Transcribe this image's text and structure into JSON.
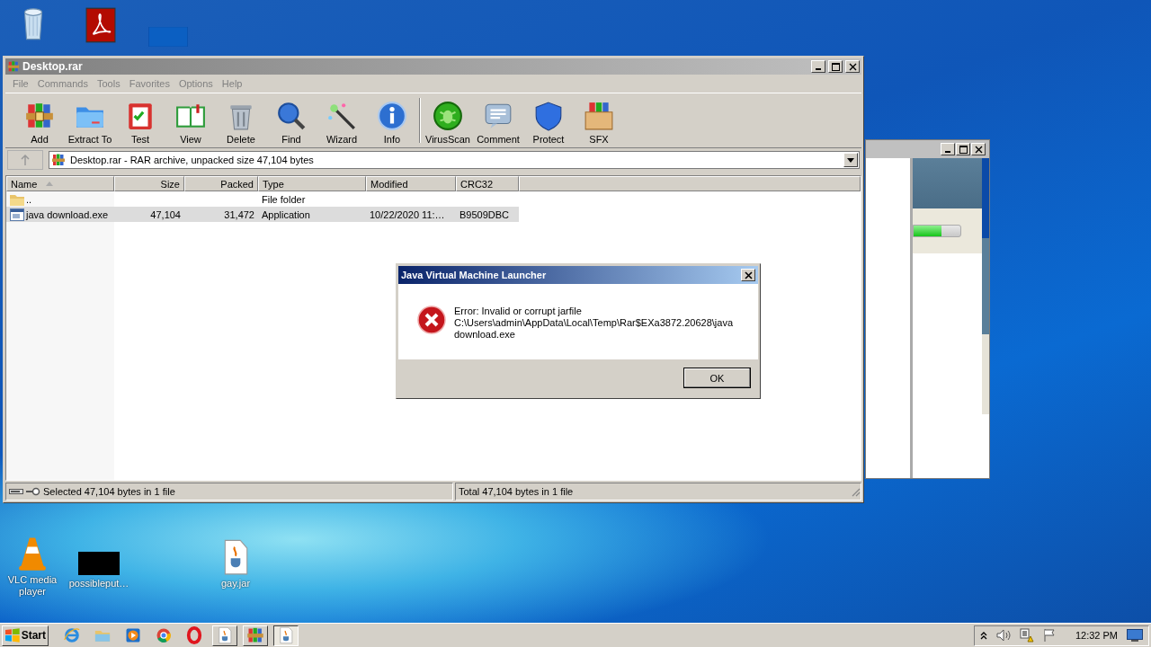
{
  "desktop_icons": [
    {
      "kind": "recycle"
    },
    {
      "kind": "acrobat"
    },
    {
      "kind": "blank"
    },
    {
      "kind": "vlc",
      "label": "VLC media player"
    },
    {
      "kind": "thumbnail",
      "label": "possibleput…"
    },
    {
      "kind": "jar",
      "label": "gay.jar"
    }
  ],
  "background_window": {
    "progress": {
      "level": 0.6
    }
  },
  "winrar": {
    "title": "Desktop.rar",
    "menu": [
      "File",
      "Commands",
      "Tools",
      "Favorites",
      "Options",
      "Help"
    ],
    "toolbar": [
      {
        "kind": "add",
        "label": "Add"
      },
      {
        "kind": "extract",
        "label": "Extract To"
      },
      {
        "kind": "test",
        "label": "Test"
      },
      {
        "kind": "view",
        "label": "View"
      },
      {
        "kind": "delete",
        "label": "Delete"
      },
      {
        "kind": "find",
        "label": "Find"
      },
      {
        "kind": "wizard",
        "label": "Wizard"
      },
      {
        "kind": "info",
        "label": "Info"
      },
      {
        "kind": "separator"
      },
      {
        "kind": "virusscan",
        "label": "VirusScan"
      },
      {
        "kind": "comment",
        "label": "Comment"
      },
      {
        "kind": "protect",
        "label": "Protect"
      },
      {
        "kind": "sfx",
        "label": "SFX"
      }
    ],
    "address": "Desktop.rar - RAR archive, unpacked size 47,104 bytes",
    "columns": [
      {
        "label": "Name",
        "sorted": true
      },
      {
        "label": "Size",
        "sorted": false
      },
      {
        "label": "Packed",
        "sorted": false
      },
      {
        "label": "Type",
        "sorted": false
      },
      {
        "label": "Modified",
        "sorted": false
      },
      {
        "label": "CRC32",
        "sorted": false
      }
    ],
    "rows": [
      {
        "kind": "folder",
        "selected": false,
        "name": "..",
        "type": "File folder"
      },
      {
        "kind": "file",
        "selected": true,
        "name": "java download.exe",
        "size": "47,104",
        "packed": "31,472",
        "type": "Application",
        "modified": "10/22/2020 11:…",
        "crc32": "B9509DBC"
      }
    ],
    "status_left": "Selected 47,104 bytes in 1 file",
    "status_right": "Total 47,104 bytes in 1 file"
  },
  "dialog": {
    "title": "Java Virtual Machine Launcher",
    "message": [
      "Error: Invalid or corrupt jarfile",
      "C:\\Users\\admin\\AppData\\Local\\Temp\\Rar$EXa3872.20628\\java",
      "download.exe"
    ],
    "button": "OK"
  },
  "taskbar": {
    "start": "Start",
    "items": [
      {
        "kind": "ie",
        "selected": false
      },
      {
        "kind": "explorer",
        "selected": false
      },
      {
        "kind": "media",
        "selected": false
      },
      {
        "kind": "chrome",
        "selected": false
      },
      {
        "kind": "opera",
        "selected": false
      },
      {
        "kind": "java",
        "selected": false
      },
      {
        "kind": "winrar",
        "selected": false
      },
      {
        "kind": "java",
        "selected": true
      }
    ],
    "clock": "12:32 PM"
  }
}
